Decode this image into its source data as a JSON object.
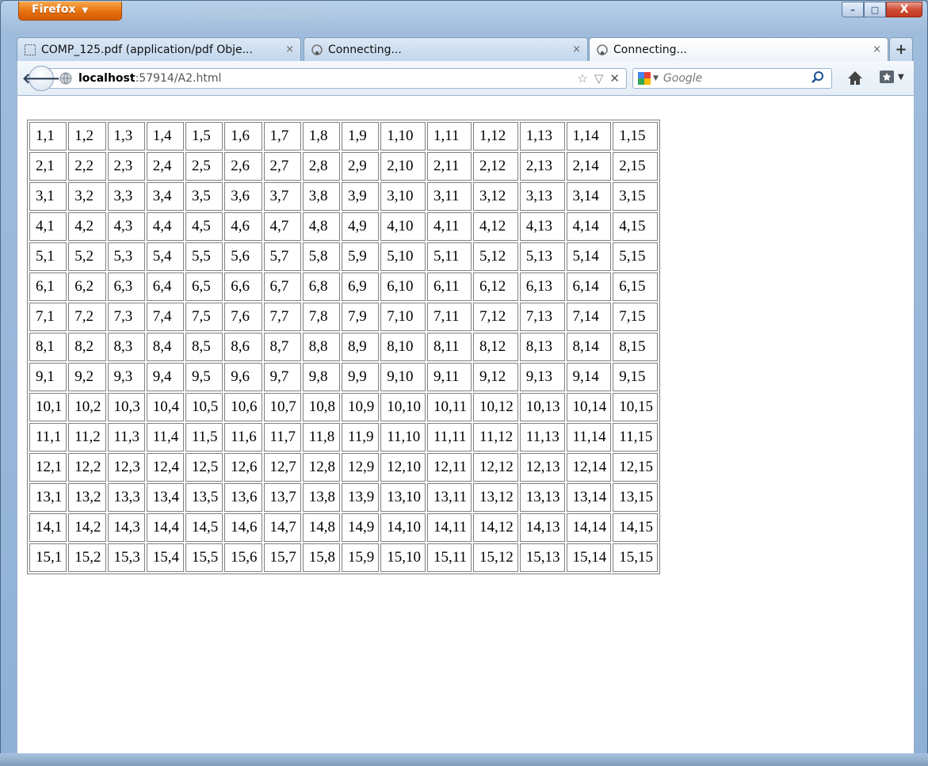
{
  "window": {
    "firefox_button": "Firefox",
    "caption_buttons": {
      "minimize": "–",
      "maximize": "□",
      "close": "X"
    }
  },
  "tabs": [
    {
      "label": "COMP_125.pdf (application/pdf Obje...",
      "icon": "page-icon",
      "active": false
    },
    {
      "label": "Connecting...",
      "icon": "loading-icon",
      "active": false
    },
    {
      "label": "Connecting...",
      "icon": "loading-icon",
      "active": true
    }
  ],
  "new_tab": "+",
  "navbar": {
    "url_host": "localhost",
    "url_rest": ":57914/A2.html",
    "search_placeholder": "Google"
  },
  "table": {
    "rows": [
      [
        "1,1",
        "1,2",
        "1,3",
        "1,4",
        "1,5",
        "1,6",
        "1,7",
        "1,8",
        "1,9",
        "1,10",
        "1,11",
        "1,12",
        "1,13",
        "1,14",
        "1,15"
      ],
      [
        "2,1",
        "2,2",
        "2,3",
        "2,4",
        "2,5",
        "2,6",
        "2,7",
        "2,8",
        "2,9",
        "2,10",
        "2,11",
        "2,12",
        "2,13",
        "2,14",
        "2,15"
      ],
      [
        "3,1",
        "3,2",
        "3,3",
        "3,4",
        "3,5",
        "3,6",
        "3,7",
        "3,8",
        "3,9",
        "3,10",
        "3,11",
        "3,12",
        "3,13",
        "3,14",
        "3,15"
      ],
      [
        "4,1",
        "4,2",
        "4,3",
        "4,4",
        "4,5",
        "4,6",
        "4,7",
        "4,8",
        "4,9",
        "4,10",
        "4,11",
        "4,12",
        "4,13",
        "4,14",
        "4,15"
      ],
      [
        "5,1",
        "5,2",
        "5,3",
        "5,4",
        "5,5",
        "5,6",
        "5,7",
        "5,8",
        "5,9",
        "5,10",
        "5,11",
        "5,12",
        "5,13",
        "5,14",
        "5,15"
      ],
      [
        "6,1",
        "6,2",
        "6,3",
        "6,4",
        "6,5",
        "6,6",
        "6,7",
        "6,8",
        "6,9",
        "6,10",
        "6,11",
        "6,12",
        "6,13",
        "6,14",
        "6,15"
      ],
      [
        "7,1",
        "7,2",
        "7,3",
        "7,4",
        "7,5",
        "7,6",
        "7,7",
        "7,8",
        "7,9",
        "7,10",
        "7,11",
        "7,12",
        "7,13",
        "7,14",
        "7,15"
      ],
      [
        "8,1",
        "8,2",
        "8,3",
        "8,4",
        "8,5",
        "8,6",
        "8,7",
        "8,8",
        "8,9",
        "8,10",
        "8,11",
        "8,12",
        "8,13",
        "8,14",
        "8,15"
      ],
      [
        "9,1",
        "9,2",
        "9,3",
        "9,4",
        "9,5",
        "9,6",
        "9,7",
        "9,8",
        "9,9",
        "9,10",
        "9,11",
        "9,12",
        "9,13",
        "9,14",
        "9,15"
      ],
      [
        "10,1",
        "10,2",
        "10,3",
        "10,4",
        "10,5",
        "10,6",
        "10,7",
        "10,8",
        "10,9",
        "10,10",
        "10,11",
        "10,12",
        "10,13",
        "10,14",
        "10,15"
      ],
      [
        "11,1",
        "11,2",
        "11,3",
        "11,4",
        "11,5",
        "11,6",
        "11,7",
        "11,8",
        "11,9",
        "11,10",
        "11,11",
        "11,12",
        "11,13",
        "11,14",
        "11,15"
      ],
      [
        "12,1",
        "12,2",
        "12,3",
        "12,4",
        "12,5",
        "12,6",
        "12,7",
        "12,8",
        "12,9",
        "12,10",
        "12,11",
        "12,12",
        "12,13",
        "12,14",
        "12,15"
      ],
      [
        "13,1",
        "13,2",
        "13,3",
        "13,4",
        "13,5",
        "13,6",
        "13,7",
        "13,8",
        "13,9",
        "13,10",
        "13,11",
        "13,12",
        "13,13",
        "13,14",
        "13,15"
      ],
      [
        "14,1",
        "14,2",
        "14,3",
        "14,4",
        "14,5",
        "14,6",
        "14,7",
        "14,8",
        "14,9",
        "14,10",
        "14,11",
        "14,12",
        "14,13",
        "14,14",
        "14,15"
      ],
      [
        "15,1",
        "15,2",
        "15,3",
        "15,4",
        "15,5",
        "15,6",
        "15,7",
        "15,8",
        "15,9",
        "15,10",
        "15,11",
        "15,12",
        "15,13",
        "15,14",
        "15,15"
      ]
    ]
  },
  "colors": {
    "firefox_orange": "#e56d0c",
    "close_red": "#c23b22",
    "chrome_blue": "#b9d1ea",
    "table_border": "#808080"
  }
}
